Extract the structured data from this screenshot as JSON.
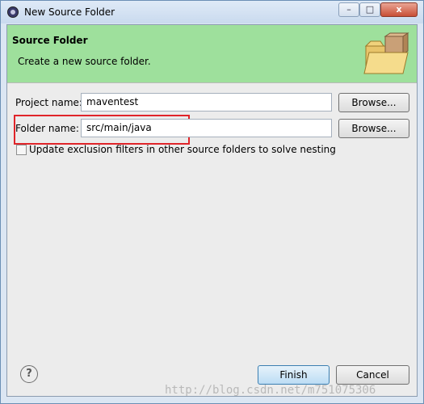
{
  "window": {
    "title": "New Source Folder"
  },
  "titlebar_buttons": {
    "minimize": "–",
    "maximize": "□",
    "close": "x"
  },
  "banner": {
    "title": "Source Folder",
    "description": "Create a new source folder."
  },
  "form": {
    "project_name_label": "Project name:",
    "project_name_value": "maventest",
    "folder_name_label": "Folder name:",
    "folder_name_value": "src/main/java",
    "browse_label": "Browse...",
    "update_exclusion_label": "Update exclusion filters in other source folders to solve nesting"
  },
  "footer": {
    "help_symbol": "?",
    "finish_label": "Finish",
    "cancel_label": "Cancel"
  },
  "watermark": "http://blog.csdn.net/m751075306",
  "colors": {
    "banner_green": "#9ee09c",
    "highlight_red": "#e0252a"
  }
}
